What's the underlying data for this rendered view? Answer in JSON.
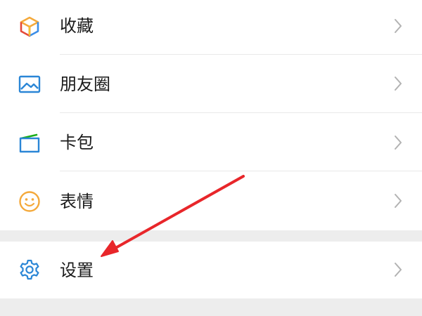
{
  "menu": {
    "items": [
      {
        "label": "收藏",
        "icon": "favorites-cube-icon"
      },
      {
        "label": "朋友圈",
        "icon": "moments-image-icon"
      },
      {
        "label": "卡包",
        "icon": "card-wallet-icon"
      },
      {
        "label": "表情",
        "icon": "smiley-face-icon"
      }
    ],
    "settings": {
      "label": "设置",
      "icon": "gear-icon"
    }
  },
  "annotation": {
    "type": "arrow",
    "color": "#e8262a",
    "points_to": "settings"
  },
  "colors": {
    "background": "#ededed",
    "row_background": "#ffffff",
    "divider": "#e9e9e9",
    "chevron": "#b2b2b2",
    "settings_icon": "#2a86d6"
  }
}
